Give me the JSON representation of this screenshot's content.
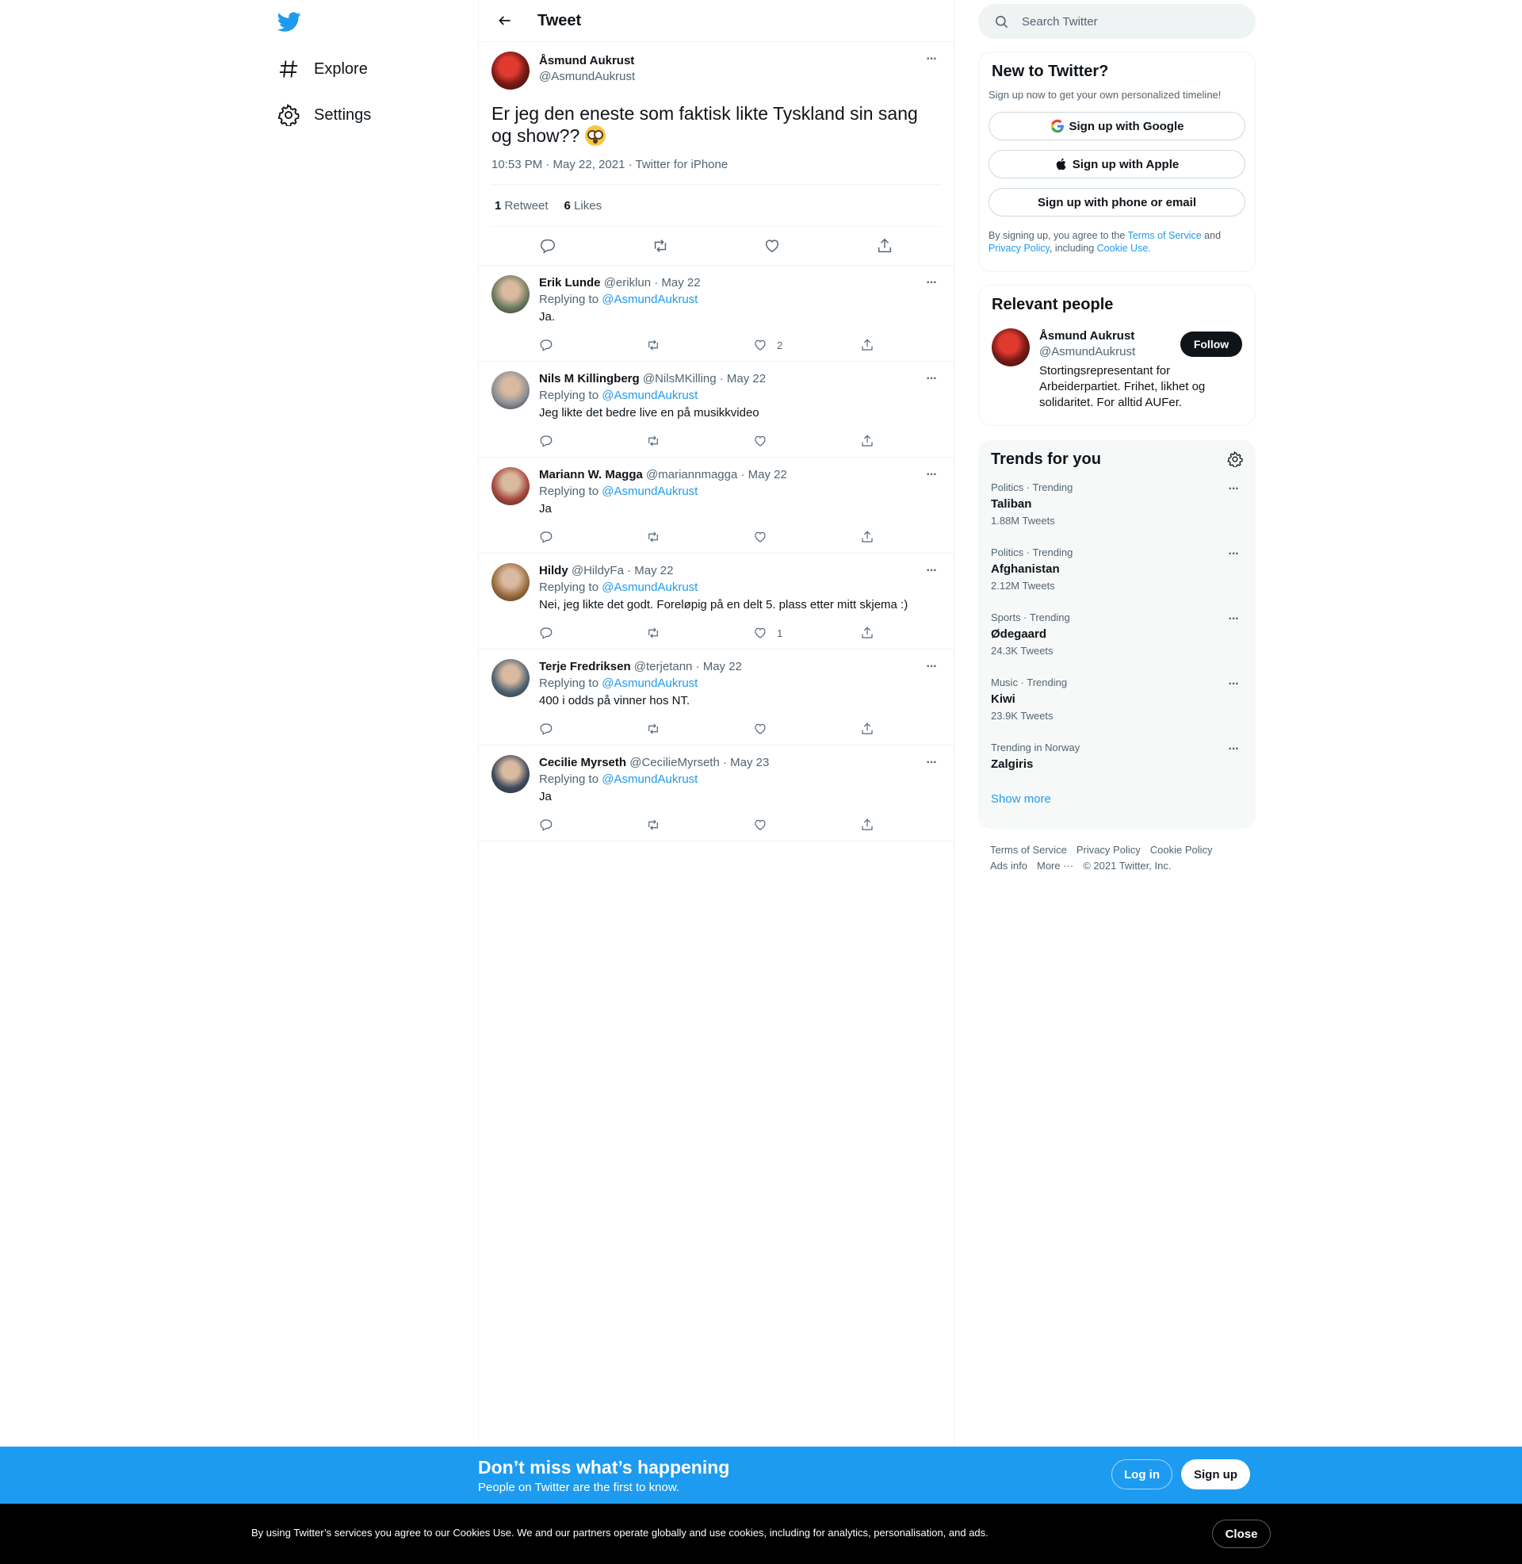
{
  "nav": {
    "logo_icon": "twitter-bird-icon",
    "items": [
      {
        "label": "Explore",
        "icon": "hashtag-icon"
      },
      {
        "label": "Settings",
        "icon": "gear-icon"
      }
    ]
  },
  "header": {
    "title": "Tweet"
  },
  "tweet": {
    "name": "Åsmund Aukrust",
    "handle": "@AsmundAukrust",
    "text": "Er jeg den eneste som faktisk likte Tyskland sin sang og show??",
    "emoji": "flushed-face",
    "meta": "10:53 PM · May 22, 2021 · Twitter for iPhone",
    "retweets": "1",
    "retweets_label": "Retweet",
    "likes": "6",
    "likes_label": "Likes"
  },
  "replies": [
    {
      "name": "Erik Lunde",
      "meta": "@eriklun · May 22",
      "replying": "Replying to",
      "to": "@AsmundAukrust",
      "text": "Ja.",
      "like_count": "2",
      "avatar_color": "#6b7a5d"
    },
    {
      "name": "Nils M Killingberg",
      "meta": "@NilsMKilling · May 22",
      "replying": "Replying to",
      "to": "@AsmundAukrust",
      "text": "Jeg likte det bedre live en på musikkvideo",
      "like_count": "",
      "avatar_color": "#8a8f95"
    },
    {
      "name": "Mariann W. Magga",
      "meta": "@mariannmagga · May 22",
      "replying": "Replying to",
      "to": "@AsmundAukrust",
      "text": "Ja",
      "like_count": "",
      "avatar_color": "#a3453a"
    },
    {
      "name": "Hildy",
      "meta": "@HildyFa · May 22",
      "replying": "Replying to",
      "to": "@AsmundAukrust",
      "text": "Nei, jeg likte det godt. Foreløpig på en delt 5. plass etter mitt skjema :)",
      "like_count": "1",
      "avatar_color": "#9a6a3c"
    },
    {
      "name": "Terje Fredriksen",
      "meta": "@terjetann · May 22",
      "replying": "Replying to",
      "to": "@AsmundAukrust",
      "text": "400 i odds på vinner hos NT.",
      "like_count": "",
      "avatar_color": "#4f6372"
    },
    {
      "name": "Cecilie Myrseth",
      "meta": "@CecilieMyrseth · May 23",
      "replying": "Replying to",
      "to": "@AsmundAukrust",
      "text": "Ja",
      "like_count": "",
      "avatar_color": "#3d4a5c"
    }
  ],
  "search": {
    "placeholder": "Search Twitter"
  },
  "new_to_twitter": {
    "title": "New to Twitter?",
    "subtitle": "Sign up now to get your own personalized timeline!",
    "google": "Sign up with Google",
    "apple": "Sign up with Apple",
    "phone": "Sign up with phone or email",
    "legal_1": "By signing up, you agree to the",
    "terms": "Terms of Service",
    "legal_and": "and",
    "privacy": "Privacy Policy",
    "legal_2": ", including",
    "cookie": "Cookie Use."
  },
  "relevant": {
    "title": "Relevant people",
    "name": "Åsmund Aukrust",
    "handle": "@AsmundAukrust",
    "bio": "Stortingsrepresentant for Arbeiderpartiet. Frihet, likhet og solidaritet. For alltid AUFer.",
    "follow": "Follow"
  },
  "trends": {
    "title": "Trends for you",
    "items": [
      {
        "category": "Politics · Trending",
        "name": "Taliban",
        "count": "1.88M Tweets"
      },
      {
        "category": "Politics · Trending",
        "name": "Afghanistan",
        "count": "2.12M Tweets"
      },
      {
        "category": "Sports · Trending",
        "name": "Ødegaard",
        "count": "24.3K Tweets"
      },
      {
        "category": "Music · Trending",
        "name": "Kiwi",
        "count": "23.9K Tweets"
      },
      {
        "category": "Trending in Norway",
        "name": "Zalgiris",
        "count": ""
      }
    ],
    "show_more": "Show more"
  },
  "footer": {
    "terms": "Terms of Service",
    "privacy": "Privacy Policy",
    "cookie": "Cookie Policy",
    "ads": "Ads info",
    "more": "More ···",
    "copyright": "© 2021 Twitter, Inc."
  },
  "bottom_bar": {
    "title": "Don’t miss what’s happening",
    "subtitle": "People on Twitter are the first to know.",
    "login": "Log in",
    "signup": "Sign up"
  },
  "cookie_bar": {
    "text": "By using Twitter’s services you agree to our Cookies Use. We and our partners operate globally and use cookies, including for analytics, personalisation, and ads.",
    "close": "Close"
  },
  "colors": {
    "accent": "#1d9bf0",
    "text": "#0f1419",
    "secondary": "#536471",
    "border": "#eff3f4"
  }
}
